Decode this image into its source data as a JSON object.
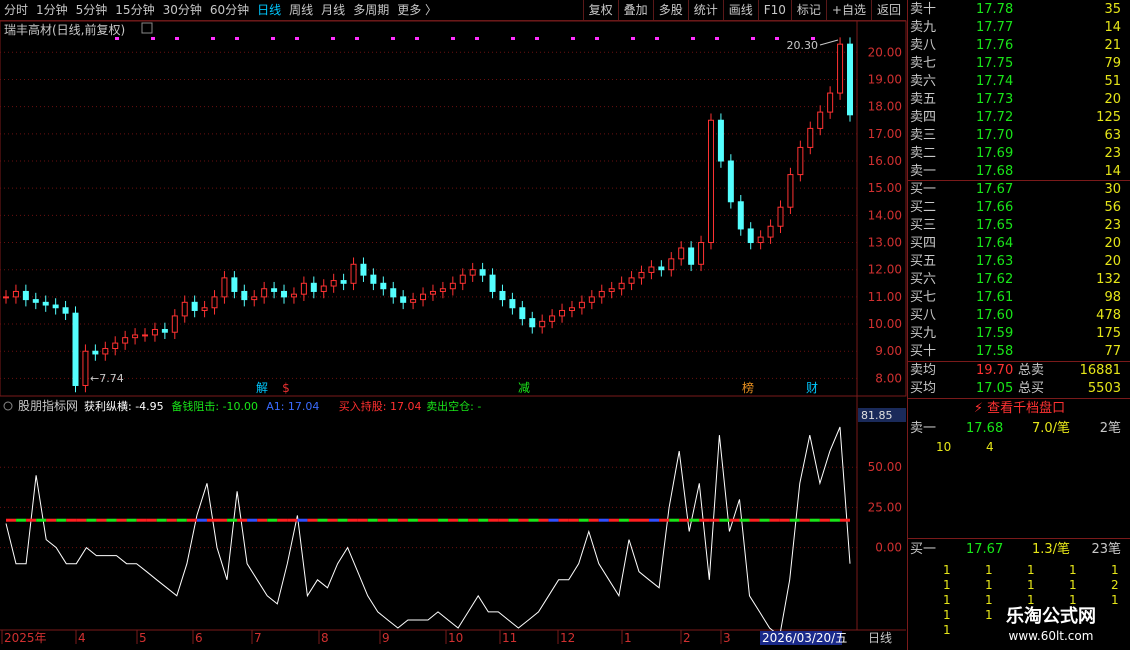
{
  "toolbar": {
    "periods": [
      "分时",
      "1分钟",
      "5分钟",
      "15分钟",
      "30分钟",
      "60分钟",
      "日线",
      "周线",
      "月线",
      "多周期",
      "更多 〉"
    ],
    "active_period": "日线",
    "right_buttons": [
      "复权",
      "叠加",
      "多股",
      "统计",
      "画线",
      "F10",
      "标记",
      "+自选",
      "返回"
    ]
  },
  "main_chart": {
    "title": "瑞丰高材(日线,前复权)",
    "high_label": "20.30",
    "low_label": "7.74",
    "y_ticks": [
      "20.00",
      "19.00",
      "18.00",
      "17.00",
      "16.00",
      "15.00",
      "14.00",
      "13.00",
      "12.00",
      "11.00",
      "10.00",
      "9.00",
      "8.00"
    ],
    "event_markers": [
      {
        "text": "解",
        "color": "#00c8ff"
      },
      {
        "text": "$",
        "color": "#e83030"
      },
      {
        "text": "减",
        "color": "#19e619"
      },
      {
        "text": "榜",
        "color": "#e89020"
      },
      {
        "text": "财",
        "color": "#00c8ff"
      }
    ]
  },
  "indicator": {
    "name": "股朋指标网",
    "items": [
      {
        "label": "获利纵横: -4.95",
        "color": "#ffffff"
      },
      {
        "label": "备钱阻击: -10.00",
        "color": "#19e619"
      },
      {
        "label": "A1: 17.04",
        "color": "#3a6bff"
      },
      {
        "label": "买入持股: 17.04",
        "color": "#ff3030"
      },
      {
        "label": "卖出空仓: -",
        "color": "#19e619"
      }
    ],
    "top_value": "81.85",
    "y_ticks": [
      "50.00",
      "25.00",
      "0.00"
    ]
  },
  "x_axis": {
    "labels": [
      "2025年",
      "4",
      "5",
      "6",
      "7",
      "8",
      "9",
      "10",
      "11",
      "12",
      "1",
      "2",
      "3"
    ],
    "current_date": "2026/03/20/五",
    "period_label": "日线"
  },
  "chart_data": {
    "type": "candlestick",
    "title": "瑞丰高材(日线,前复权)",
    "y_axis_range": [
      7.5,
      20.6
    ],
    "price_series": [
      11.0,
      11.2,
      10.9,
      10.8,
      10.7,
      10.6,
      10.4,
      7.74,
      9.0,
      8.9,
      9.1,
      9.3,
      9.5,
      9.6,
      9.6,
      9.8,
      9.7,
      10.3,
      10.8,
      10.5,
      10.6,
      11.0,
      11.7,
      11.2,
      10.9,
      11.0,
      11.3,
      11.2,
      11.0,
      11.1,
      11.5,
      11.2,
      11.4,
      11.6,
      11.5,
      12.2,
      11.8,
      11.5,
      11.3,
      11.0,
      10.8,
      10.9,
      11.1,
      11.2,
      11.3,
      11.5,
      11.8,
      12.0,
      11.8,
      11.2,
      10.9,
      10.6,
      10.2,
      9.9,
      10.1,
      10.3,
      10.5,
      10.6,
      10.8,
      11.0,
      11.2,
      11.3,
      11.5,
      11.7,
      11.9,
      12.1,
      12.0,
      12.4,
      12.8,
      12.2,
      13.0,
      17.5,
      16.0,
      14.5,
      13.5,
      13.0,
      13.2,
      13.6,
      14.3,
      15.5,
      16.5,
      17.2,
      17.8,
      18.5,
      20.3,
      17.7
    ],
    "indicator_series": {
      "获利纵横": [
        15,
        -10,
        -10,
        45,
        5,
        0,
        -10,
        -10,
        0,
        -5,
        -5,
        -5,
        -10,
        -10,
        -15,
        -20,
        -25,
        -30,
        -10,
        20,
        40,
        0,
        -20,
        35,
        -10,
        -20,
        -30,
        -35,
        -10,
        20,
        -30,
        -20,
        -25,
        -10,
        0,
        -15,
        -30,
        -40,
        -45,
        -50,
        -45,
        -45,
        -45,
        -40,
        -45,
        -50,
        -40,
        -30,
        -40,
        -40,
        -45,
        -50,
        -45,
        -40,
        -30,
        -20,
        -20,
        -10,
        10,
        -10,
        -20,
        -30,
        5,
        -15,
        -20,
        -25,
        25,
        60,
        10,
        40,
        -20,
        70,
        10,
        30,
        -30,
        -40,
        -50,
        -55,
        -20,
        40,
        70,
        40,
        60,
        75,
        -10
      ],
      "买入持股": [
        17.04,
        17.04,
        17.04,
        17.04,
        17.04,
        17.04,
        17.04,
        17.04,
        17.04,
        17.04,
        17.04,
        17.04,
        17.04,
        17.04,
        17.04,
        17.04,
        17.04,
        17.04,
        17.04,
        17.04,
        17.04,
        17.04,
        17.04,
        17.04,
        17.04,
        17.04,
        17.04,
        17.04,
        17.04,
        17.04,
        17.04,
        17.04,
        17.04,
        17.04,
        17.04,
        17.04,
        17.04,
        17.04,
        17.04,
        17.04,
        17.04,
        17.04,
        17.04,
        17.04,
        17.04,
        17.04,
        17.04,
        17.04,
        17.04,
        17.04,
        17.04,
        17.04,
        17.04,
        17.04,
        17.04,
        17.04,
        17.04,
        17.04,
        17.04,
        17.04,
        17.04,
        17.04,
        17.04,
        17.04,
        17.04,
        17.04,
        17.04,
        17.04,
        17.04,
        17.04,
        17.04,
        17.04,
        17.04,
        17.04,
        17.04,
        17.04,
        17.04,
        17.04,
        17.04,
        17.04,
        17.04,
        17.04,
        17.04,
        17.04,
        17.04
      ]
    },
    "indicator_range": [
      -50,
      81.85
    ]
  },
  "orderbook": {
    "sell": [
      {
        "label": "卖十",
        "price": "17.78",
        "vol": "35"
      },
      {
        "label": "卖九",
        "price": "17.77",
        "vol": "14"
      },
      {
        "label": "卖八",
        "price": "17.76",
        "vol": "21"
      },
      {
        "label": "卖七",
        "price": "17.75",
        "vol": "79"
      },
      {
        "label": "卖六",
        "price": "17.74",
        "vol": "51"
      },
      {
        "label": "卖五",
        "price": "17.73",
        "vol": "20"
      },
      {
        "label": "卖四",
        "price": "17.72",
        "vol": "125"
      },
      {
        "label": "卖三",
        "price": "17.70",
        "vol": "63"
      },
      {
        "label": "卖二",
        "price": "17.69",
        "vol": "23"
      },
      {
        "label": "卖一",
        "price": "17.68",
        "vol": "14"
      }
    ],
    "buy": [
      {
        "label": "买一",
        "price": "17.67",
        "vol": "30"
      },
      {
        "label": "买二",
        "price": "17.66",
        "vol": "56"
      },
      {
        "label": "买三",
        "price": "17.65",
        "vol": "23"
      },
      {
        "label": "买四",
        "price": "17.64",
        "vol": "20"
      },
      {
        "label": "买五",
        "price": "17.63",
        "vol": "20"
      },
      {
        "label": "买六",
        "price": "17.62",
        "vol": "132"
      },
      {
        "label": "买七",
        "price": "17.61",
        "vol": "98"
      },
      {
        "label": "买八",
        "price": "17.60",
        "vol": "478"
      },
      {
        "label": "买九",
        "price": "17.59",
        "vol": "175"
      },
      {
        "label": "买十",
        "price": "17.58",
        "vol": "77"
      }
    ],
    "avg_sell_label": "卖均",
    "avg_sell": "19.70",
    "total_sell_label": "总卖",
    "total_sell": "16881",
    "avg_buy_label": "买均",
    "avg_buy": "17.05",
    "total_buy_label": "总买",
    "total_buy": "5503",
    "thousand_link": "查看千档盘口",
    "queue_sell": {
      "label": "卖一",
      "price": "17.68",
      "per": "7.0/笔",
      "count": "2笔",
      "orders": [
        "10",
        "4"
      ]
    },
    "queue_buy": {
      "label": "买一",
      "price": "17.67",
      "per": "1.3/笔",
      "count": "23笔",
      "orders": [
        [
          "1",
          "1",
          "1",
          "1",
          "1"
        ],
        [
          "1",
          "1",
          "1",
          "1",
          "2"
        ],
        [
          "1",
          "1",
          "1",
          "1",
          "1"
        ],
        [
          "1",
          "1",
          "1",
          "1",
          ""
        ],
        [
          "1",
          "",
          "",
          "",
          ""
        ]
      ]
    }
  },
  "watermark": {
    "title": "乐淘公式网",
    "url": "www.60lt.com"
  }
}
